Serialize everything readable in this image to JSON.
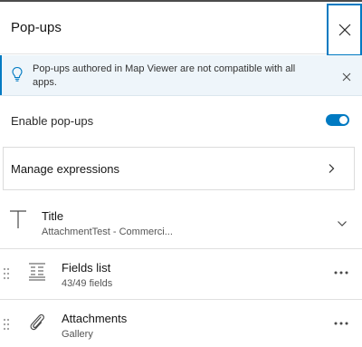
{
  "header": {
    "title": "Pop-ups",
    "close_icon": "close-icon"
  },
  "notice": {
    "icon": "lightbulb-icon",
    "text": "Pop-ups authored in Map Viewer are not compatible with all apps.",
    "close_icon": "close-icon"
  },
  "enable_popups": {
    "label": "Enable pop-ups",
    "enabled": true
  },
  "manage_expressions": {
    "label": "Manage expressions",
    "icon": "chevron-right-icon"
  },
  "title_element": {
    "icon": "text-t-icon",
    "heading": "Title",
    "subtitle": "AttachmentTest - Commerci...",
    "expand_icon": "chevron-down-icon"
  },
  "elements": [
    {
      "icon": "fields-list-icon",
      "heading": "Fields list",
      "subtitle": "43/49 fields"
    },
    {
      "icon": "paperclip-icon",
      "heading": "Attachments",
      "subtitle": "Gallery"
    }
  ],
  "colors": {
    "accent": "#007ac2",
    "notice_bg": "#eef5fa",
    "divider": "#e0e0e0"
  }
}
